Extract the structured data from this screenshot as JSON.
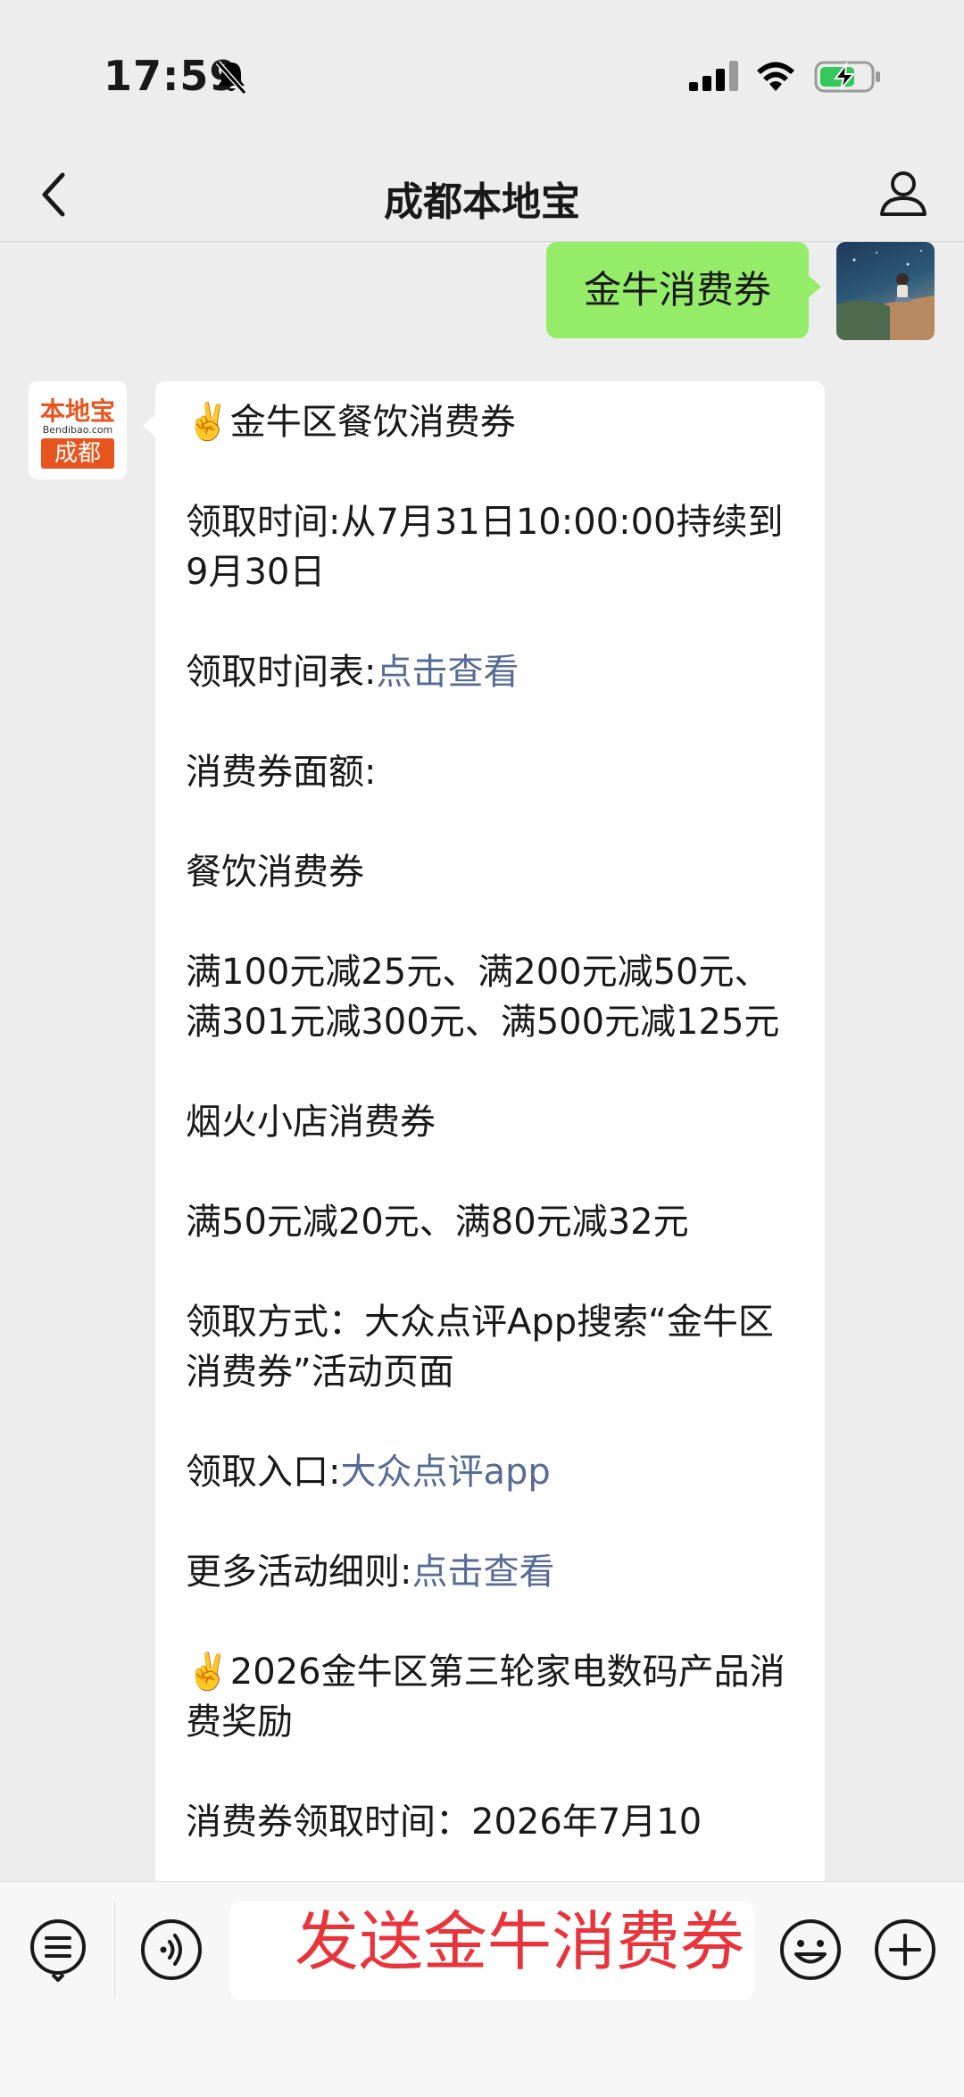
{
  "status_bar": {
    "time": "17:59"
  },
  "nav": {
    "title": "成都本地宝"
  },
  "chat": {
    "user_message": "金牛消费券",
    "bot_avatar": {
      "logo_text": "本地宝",
      "logo_site": "Bendibao.com",
      "logo_city": "成都"
    },
    "bot_message": [
      {
        "text": "✌️金牛区餐饮消费券"
      },
      {
        "text": ""
      },
      {
        "text": "领取时间:从7月31日10:00:00持续到9月30日"
      },
      {
        "text": ""
      },
      {
        "text": "领取时间表:",
        "link": "点击查看"
      },
      {
        "text": ""
      },
      {
        "text": "消费券面额:"
      },
      {
        "text": ""
      },
      {
        "text": "餐饮消费券"
      },
      {
        "text": ""
      },
      {
        "text": "满100元减25元、满200元减50元、满301元减300元、满500元减125元"
      },
      {
        "text": ""
      },
      {
        "text": "烟火小店消费券"
      },
      {
        "text": ""
      },
      {
        "text": "满50元减20元、满80元减32元"
      },
      {
        "text": ""
      },
      {
        "text": "领取方式：大众点评App搜索“金牛区消费券”活动页面"
      },
      {
        "text": ""
      },
      {
        "text": "领取入口:",
        "link": "大众点评app"
      },
      {
        "text": ""
      },
      {
        "text": "更多活动细则:",
        "link": "点击查看"
      },
      {
        "text": ""
      },
      {
        "text": "✌️2026金牛区第三轮家电数码产品消费奖励"
      },
      {
        "text": ""
      },
      {
        "text": "消费券领取时间：2026年7月10"
      }
    ]
  },
  "input_bar": {
    "input_value": "发送金牛消费券"
  },
  "colors": {
    "user_bubble": "#95ec69",
    "link": "#576b95",
    "input_text": "#e8343a",
    "brand_orange": "#e8541e"
  }
}
